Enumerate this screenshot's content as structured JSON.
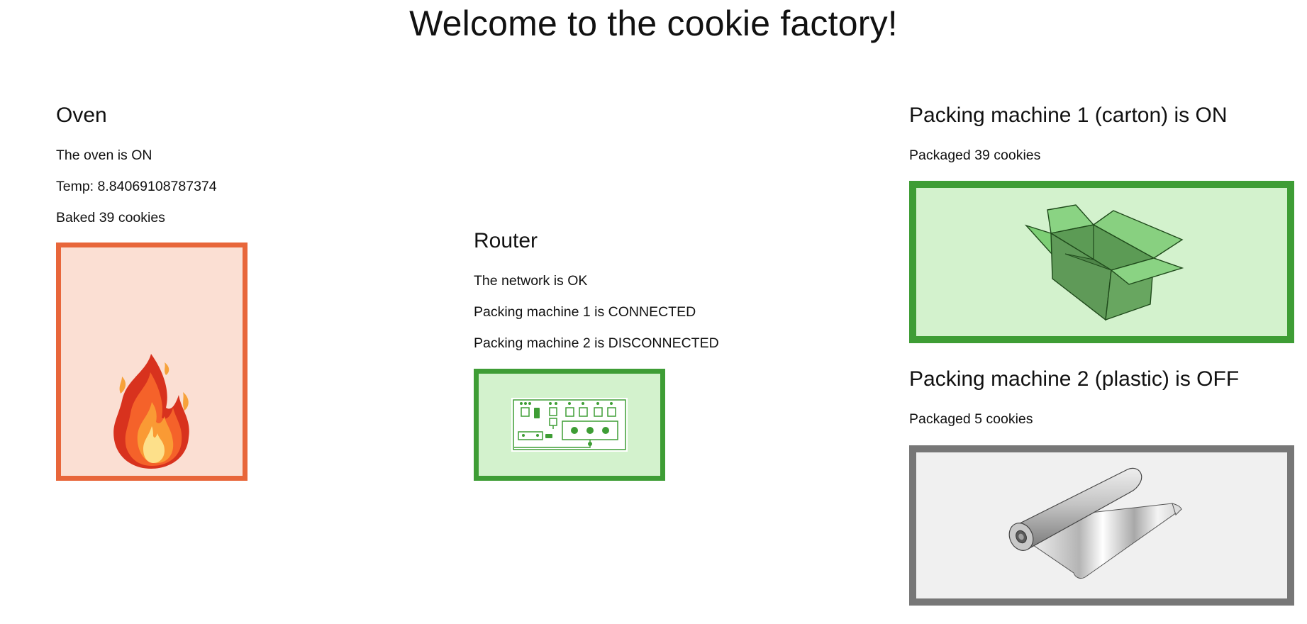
{
  "page": {
    "title": "Welcome to the cookie factory!"
  },
  "oven": {
    "heading": "Oven",
    "status": "The oven is ON",
    "temp": "Temp: 8.84069108787374",
    "baked": "Baked 39 cookies",
    "icon": "fire-icon",
    "border_color": "#e8663a",
    "fill_color": "#fbdfd3"
  },
  "router": {
    "heading": "Router",
    "network": "The network is OK",
    "pm1": "Packing machine 1 is CONNECTED",
    "pm2": "Packing machine 2 is DISCONNECTED",
    "icon": "circuit-board-icon",
    "border_color": "#3e9d35",
    "fill_color": "#d3f2cd"
  },
  "pm1": {
    "heading": "Packing machine 1 (carton) is ON",
    "packaged": "Packaged 39 cookies",
    "icon": "carton-box-icon",
    "border_color": "#3e9d35",
    "fill_color": "#d3f2cd"
  },
  "pm2": {
    "heading": "Packing machine 2 (plastic) is OFF",
    "packaged": "Packaged 5 cookies",
    "icon": "plastic-wrap-roll-icon",
    "border_color": "#777777",
    "fill_color": "#f0f0f0"
  }
}
